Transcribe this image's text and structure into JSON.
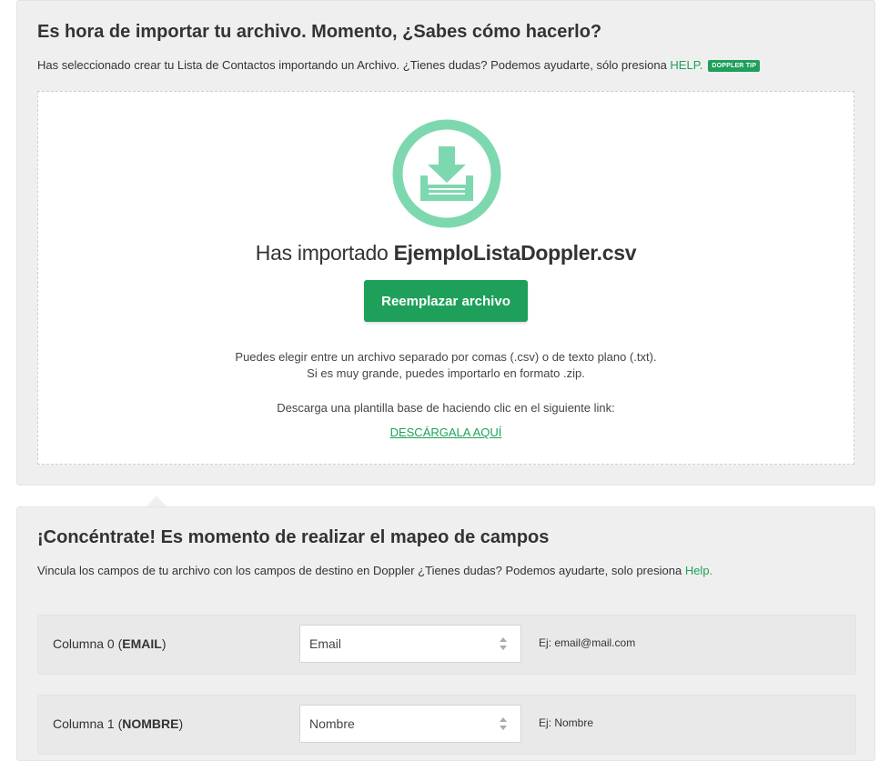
{
  "import": {
    "title": "Es hora de importar tu archivo. Momento, ¿Sabes cómo hacerlo?",
    "subtitle": "Has seleccionado crear tu Lista de Contactos importando un Archivo. ¿Tienes dudas? Podemos ayudarte, sólo presiona ",
    "help_label": "HELP.",
    "tip_badge": "DOPPLER TIP",
    "icon": "download-tray-icon",
    "imported_prefix": "Has importado ",
    "file_name": "EjemploListaDoppler.csv",
    "replace_button": "Reemplazar archivo",
    "info_line1": "Puedes elegir entre un archivo separado por comas (.csv) o de texto plano (.txt).",
    "info_line2": "Si es muy grande, puedes importarlo en formato .zip.",
    "template_text": "Descarga una plantilla base de haciendo clic en el siguiente link:",
    "download_link": "DESCÁRGALA AQUÍ"
  },
  "mapping": {
    "title": "¡Concéntrate! Es momento de realizar el mapeo de campos",
    "subtitle": "Vincula los campos de tu archivo con los campos de destino en Doppler ¿Tienes dudas? Podemos ayudarte, solo presiona ",
    "help_label": "Help.",
    "rows": [
      {
        "column_prefix": "Columna 0 (",
        "column_name": "EMAIL",
        "column_suffix": ")",
        "select_value": "Email",
        "example": "Ej: email@mail.com"
      },
      {
        "column_prefix": "Columna 1 (",
        "column_name": "NOMBRE",
        "column_suffix": ")",
        "select_value": "Nombre",
        "example": "Ej: Nombre"
      }
    ]
  },
  "colors": {
    "accent": "#1fa05a",
    "icon_green": "#7dd8b0",
    "panel_bg": "#efefef"
  }
}
